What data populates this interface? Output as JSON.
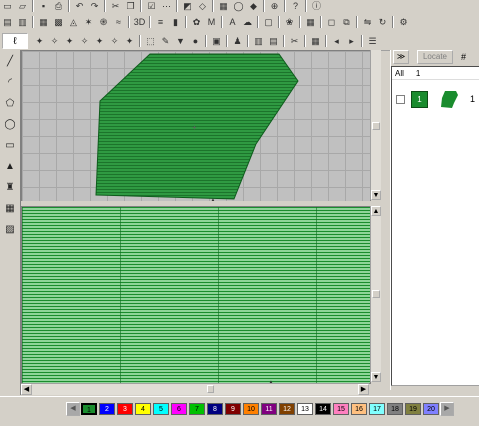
{
  "toolbar1": {
    "icons": [
      "new-icon",
      "open-icon",
      "sep",
      "save-icon",
      "print-icon",
      "sep",
      "undo-icon",
      "redo-icon",
      "sep",
      "cut-icon",
      "copy-icon",
      "sep",
      "check-icon",
      "stitch-icon",
      "sep",
      "eraser-icon",
      "reshape-icon",
      "sep",
      "grid-icon",
      "hoop-icon",
      "color-icon",
      "sep",
      "zoom-icon",
      "sep",
      "help-icon",
      "sep",
      "about-icon"
    ]
  },
  "toolbar2": {
    "icons": [
      "fill-icon",
      "satin-icon",
      "sep",
      "tatami-icon",
      "crosshatch-icon",
      "fan-icon",
      "radial-icon",
      "spiral-icon",
      "wave-icon",
      "sep",
      "3d-label",
      "sep",
      "align-icon",
      "column-icon",
      "sep",
      "applique-icon",
      "monogram-icon",
      "sep",
      "lettering-icon",
      "cloud-icon",
      "sep",
      "frame-icon",
      "sep",
      "motif-icon",
      "sep",
      "table-icon",
      "sep",
      "outline-icon",
      "split-icon",
      "sep",
      "mirror-icon",
      "rotate-icon",
      "sep",
      "gear-icon"
    ],
    "label_3d": "3D"
  },
  "toolbar3": {
    "pen_glyph": "ℓ",
    "icons": [
      "node1-icon",
      "node2-icon",
      "node3-icon",
      "node4-icon",
      "node5-icon",
      "node6-icon",
      "node7-icon",
      "sep",
      "select-icon",
      "brush-icon",
      "down-arrow-icon",
      "pin-icon",
      "sep",
      "image-icon",
      "sep",
      "people-icon",
      "sep",
      "snap-icon",
      "stitch-sim-icon",
      "sep",
      "trim-icon",
      "sep",
      "calendar-icon",
      "sep",
      "slow-icon",
      "fast-icon",
      "sep",
      "list-icon"
    ]
  },
  "left_tools": [
    "line-icon",
    "arc-icon",
    "polygon-icon",
    "ellipse-icon",
    "rectangle-icon",
    "fill-tool-icon",
    "stamp-icon",
    "grid-tool-icon",
    "hatch-icon"
  ],
  "right_panel": {
    "arrows": "≫",
    "locate": "Locate",
    "hash": "#",
    "col_all": "All",
    "col_1": "1",
    "object_number": "1",
    "stitch_count": "1"
  },
  "palette": {
    "prev": "◀",
    "next": "▶",
    "selected": 1,
    "colors": [
      {
        "n": "1",
        "bg": "#1a8c2e",
        "fg": "#000"
      },
      {
        "n": "2",
        "bg": "#0000ff",
        "fg": "#fff"
      },
      {
        "n": "3",
        "bg": "#ff0000",
        "fg": "#fff"
      },
      {
        "n": "4",
        "bg": "#ffff00",
        "fg": "#000"
      },
      {
        "n": "5",
        "bg": "#00ffff",
        "fg": "#000"
      },
      {
        "n": "6",
        "bg": "#ff00ff",
        "fg": "#000"
      },
      {
        "n": "7",
        "bg": "#00c000",
        "fg": "#000"
      },
      {
        "n": "8",
        "bg": "#000080",
        "fg": "#fff"
      },
      {
        "n": "9",
        "bg": "#800000",
        "fg": "#fff"
      },
      {
        "n": "10",
        "bg": "#ff8000",
        "fg": "#000"
      },
      {
        "n": "11",
        "bg": "#800080",
        "fg": "#fff"
      },
      {
        "n": "12",
        "bg": "#804000",
        "fg": "#fff"
      },
      {
        "n": "13",
        "bg": "#ffffff",
        "fg": "#000"
      },
      {
        "n": "14",
        "bg": "#000000",
        "fg": "#fff"
      },
      {
        "n": "15",
        "bg": "#ff80c0",
        "fg": "#000"
      },
      {
        "n": "16",
        "bg": "#ffc080",
        "fg": "#000"
      },
      {
        "n": "17",
        "bg": "#80ffff",
        "fg": "#000"
      },
      {
        "n": "18",
        "bg": "#808080",
        "fg": "#000"
      },
      {
        "n": "19",
        "bg": "#808040",
        "fg": "#000"
      },
      {
        "n": "20",
        "bg": "#8080ff",
        "fg": "#000"
      }
    ]
  },
  "design": {
    "fill_color": "#1a8c2e"
  }
}
